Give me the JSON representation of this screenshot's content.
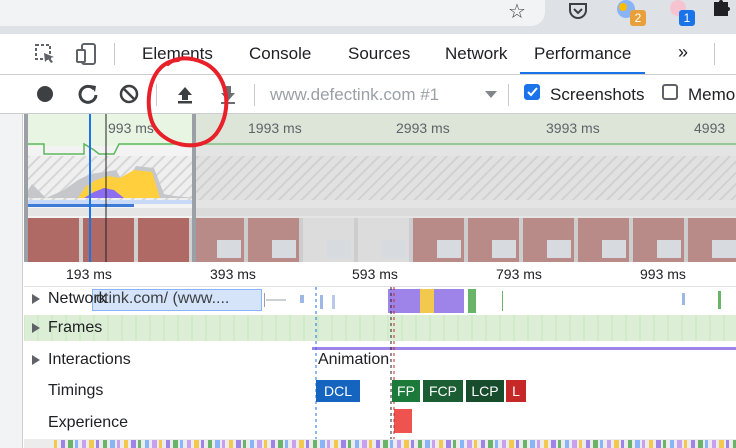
{
  "extensions": {
    "badge_2": "2",
    "badge_1": "1"
  },
  "devtools": {
    "tabs": [
      {
        "label": "Elements"
      },
      {
        "label": "Console"
      },
      {
        "label": "Sources"
      },
      {
        "label": "Network"
      },
      {
        "label": "Performance"
      }
    ],
    "more_tabs": "»",
    "active_tab": "Performance"
  },
  "toolbar": {
    "profile_select": "www.defectink.com #1",
    "screenshots_label": "Screenshots",
    "screenshots_checked": true,
    "memory_label": "Memo",
    "memory_checked": false
  },
  "overview": {
    "ticks": [
      "993 ms",
      "1993 ms",
      "2993 ms",
      "3993 ms",
      "4993"
    ]
  },
  "timeline": {
    "ticks": [
      "193 ms",
      "393 ms",
      "593 ms",
      "793 ms",
      "993 ms"
    ],
    "tracks": {
      "network": "Network",
      "network_item": "ctink.com/ (www....",
      "frames": "Frames",
      "interactions": "Interactions",
      "animation": "Animation",
      "timings": "Timings",
      "experience": "Experience"
    },
    "markers": [
      {
        "label": "DCL",
        "color": "#1565c0"
      },
      {
        "label": "FP",
        "color": "#1b7a3a"
      },
      {
        "label": "FCP",
        "color": "#1b5e33"
      },
      {
        "label": "LCP",
        "color": "#174d2c"
      },
      {
        "label": "L",
        "color": "#c62828"
      }
    ]
  },
  "colors": {
    "accent": "#1a73e8",
    "annotation": "#e8202a"
  }
}
